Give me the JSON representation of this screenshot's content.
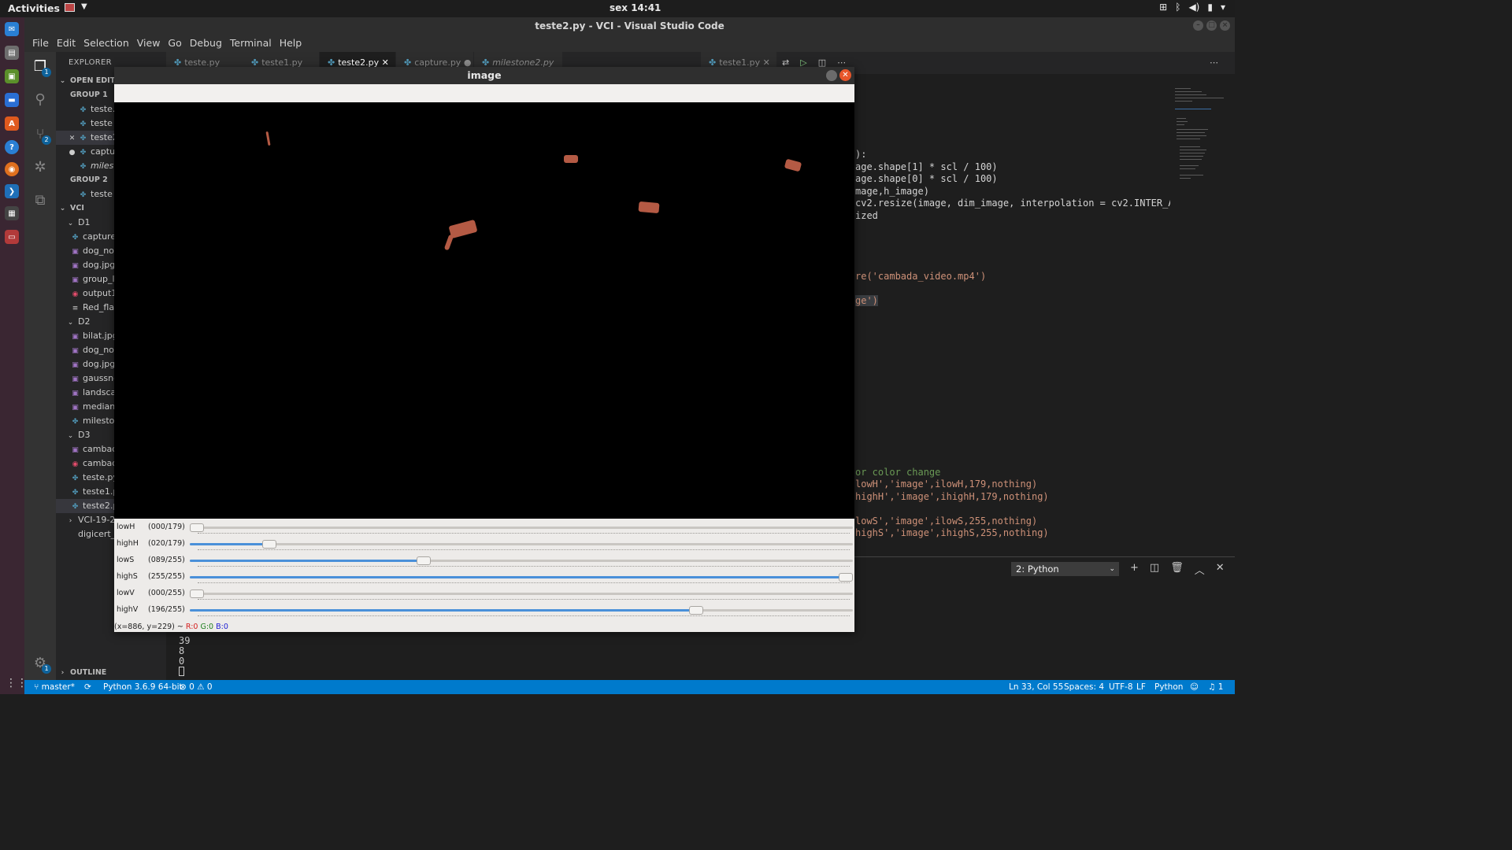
{
  "system": {
    "activities": "Activities",
    "clock": "sex 14:41",
    "tray_icons": [
      "network-icon",
      "bluetooth-icon",
      "volume-icon",
      "battery-icon",
      "power-menu-icon"
    ]
  },
  "vscode": {
    "window_title": "teste2.py - VCI - Visual Studio Code",
    "menu": [
      "File",
      "Edit",
      "Selection",
      "View",
      "Go",
      "Debug",
      "Terminal",
      "Help"
    ],
    "explorer": {
      "header": "EXPLORER",
      "open_editors": "OPEN EDIT...",
      "group1": "GROUP 1",
      "group1_files": [
        "teste.",
        "teste",
        "teste2",
        "captu",
        "milest"
      ],
      "group2": "GROUP 2",
      "group2_files": [
        "teste"
      ],
      "workspace": "VCI",
      "d1": "D1",
      "d1_files": [
        "capture.",
        "dog_nor",
        "dog.jpg",
        "group_l",
        "output1",
        "Red_flag"
      ],
      "d2": "D2",
      "d2_files": [
        "bilat.jpg",
        "dog_nor",
        "dog.jpg",
        "gaussno",
        "landscap",
        "median_",
        "milestor"
      ],
      "d3": "D3",
      "d3_files": [
        "cambad",
        "cambad",
        "teste.py",
        "teste1.p",
        "teste2.p"
      ],
      "vci_folder": "VCI-19-20",
      "digicert": "digicert_",
      "outline": "OUTLINE"
    },
    "tabs": [
      "teste.py",
      "teste1.py",
      "teste2.py",
      "capture.py",
      "milestone2.py"
    ],
    "tab_group2": "teste1.py",
    "code_lines": [
      {
        "text": "):"
      },
      {
        "text": "age.shape[1] * scl / 100)"
      },
      {
        "text": "age.shape[0] * scl / 100)"
      },
      {
        "text": "mage,h_image)"
      },
      {
        "text": "cv2.resize(image, dim_image, interpolation = cv2.INTER_AREA"
      },
      {
        "text": "ized"
      },
      {
        "text": "re('cambada_video.mp4')"
      },
      {
        "text": "ge')"
      },
      {
        "text": "or color change"
      },
      {
        "text": "lowH','image',ilowH,179,nothing)"
      },
      {
        "text": "highH','image',ihighH,179,nothing)"
      },
      {
        "text": "lowS','image',ilowS,255,nothing)"
      },
      {
        "text": "highS','image',ihighS,255,nothing)"
      }
    ],
    "terminal": {
      "selected": "2: Python",
      "output": [
        "39",
        "8",
        "0"
      ]
    },
    "status": {
      "branch": "master*",
      "interpreter": "Python 3.6.9 64-bit",
      "problems": "0 ⚠ 0",
      "position": "Ln 33, Col 55",
      "spaces": "Spaces: 4",
      "encoding": "UTF-8",
      "eol": "LF",
      "language": "Python",
      "notifications": "1"
    }
  },
  "opencv_window": {
    "title": "image",
    "trackbars": [
      {
        "name": "lowH",
        "value": "(000/179)",
        "fraction": 0.0
      },
      {
        "name": "highH",
        "value": "(020/179)",
        "fraction": 0.112
      },
      {
        "name": "lowS",
        "value": "(089/255)",
        "fraction": 0.349
      },
      {
        "name": "highS",
        "value": "(255/255)",
        "fraction": 1.0
      },
      {
        "name": "lowV",
        "value": "(000/255)",
        "fraction": 0.0
      },
      {
        "name": "highV",
        "value": "(196/255)",
        "fraction": 0.769
      }
    ],
    "status_prefix": "(x=886, y=229) ~",
    "status_r": "R:0",
    "status_g": "G:0",
    "status_b": "B:0"
  }
}
